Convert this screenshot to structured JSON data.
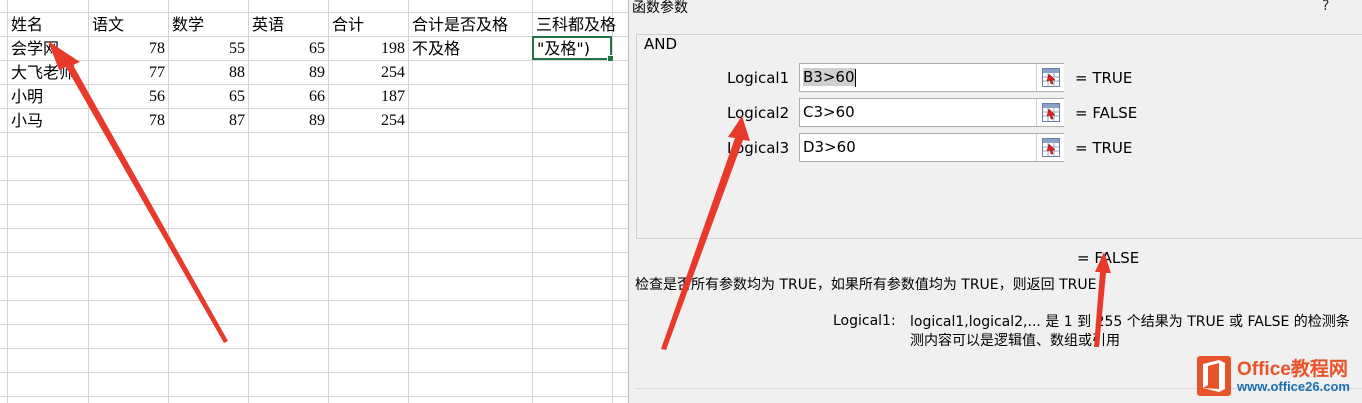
{
  "sheet": {
    "headers": [
      "姓名",
      "语文",
      "数学",
      "英语",
      "合计",
      "合计是否及格",
      "三科都及格"
    ],
    "rows": [
      {
        "name": "会学网",
        "chinese": "78",
        "math": "55",
        "english": "65",
        "total": "198",
        "pass_total": "不及格",
        "pass_all": "\"及格\")"
      },
      {
        "name": "大飞老师",
        "chinese": "77",
        "math": "88",
        "english": "89",
        "total": "254",
        "pass_total": "",
        "pass_all": ""
      },
      {
        "name": "小明",
        "chinese": "56",
        "math": "65",
        "english": "66",
        "total": "187",
        "pass_total": "",
        "pass_all": ""
      },
      {
        "name": "小马",
        "chinese": "78",
        "math": "87",
        "english": "89",
        "total": "254",
        "pass_total": "",
        "pass_all": ""
      }
    ]
  },
  "dialog": {
    "title": "函数参数",
    "help": "?",
    "function_name": "AND",
    "args": [
      {
        "label": "Logical1",
        "value": "B3>60",
        "result": "=  TRUE"
      },
      {
        "label": "Logical2",
        "value": "C3>60",
        "result": "=  FALSE"
      },
      {
        "label": "Logical3",
        "value": "D3>60",
        "result": "=  TRUE"
      }
    ],
    "formula_result": "=  FALSE",
    "description": "检查是否所有参数均为 TRUE，如果所有参数值均为 TRUE，则返回 TRUE",
    "param_name": "Logical1:",
    "param_description_line1": "logical1,logical2,... 是 1 到 255 个结果为 TRUE 或 FALSE 的检测条",
    "param_description_line2": "测内容可以是逻辑值、数组或引用"
  },
  "watermark": {
    "brand": "Office教程网",
    "url": "www.office26.com"
  },
  "colors": {
    "arrow": "#e8392b",
    "active_cell_border": "#217346",
    "watermark_orange": "#e8542a",
    "watermark_blue": "#1a6fb4"
  }
}
